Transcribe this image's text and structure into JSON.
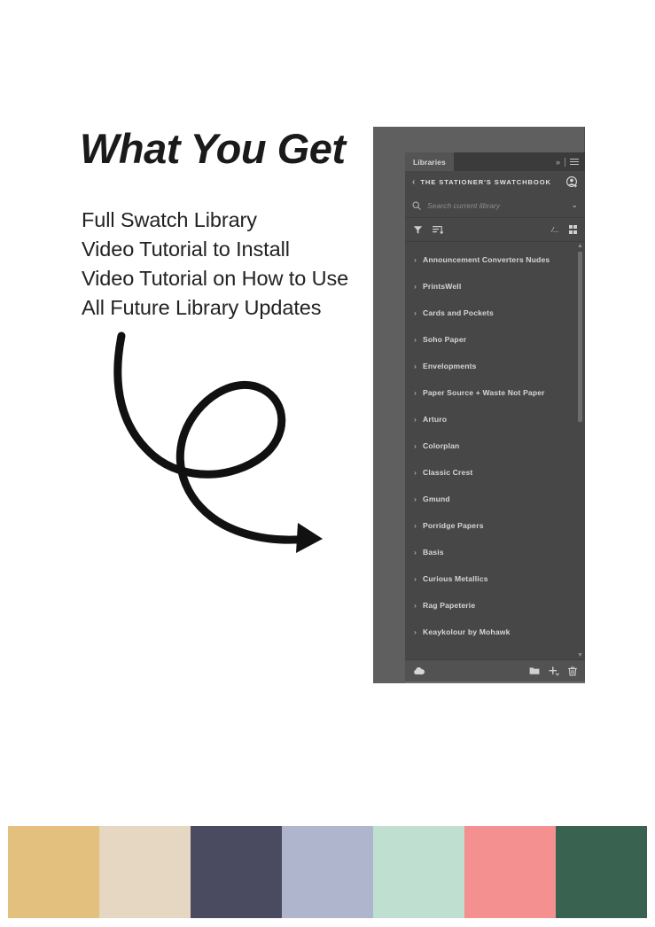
{
  "headline": "What You Get",
  "features": [
    "Full Swatch Library",
    "Video Tutorial to Install",
    "Video Tutorial on How to Use",
    "All Future Library Updates"
  ],
  "panel": {
    "tab_label": "Libraries",
    "collapse_icon": "»",
    "library_title": "THE STATIONER'S SWATCHBOOK",
    "back_icon": "‹",
    "search_placeholder": "Search current library",
    "search_value": "",
    "view_label": "/...",
    "items": [
      {
        "label": "Announcement Converters Nudes"
      },
      {
        "label": "PrintsWell"
      },
      {
        "label": "Cards and Pockets"
      },
      {
        "label": "Soho Paper"
      },
      {
        "label": "Envelopments"
      },
      {
        "label": "Paper Source + Waste Not Paper"
      },
      {
        "label": "Arturo"
      },
      {
        "label": "Colorplan"
      },
      {
        "label": "Classic Crest"
      },
      {
        "label": "Gmund"
      },
      {
        "label": "Porridge Papers"
      },
      {
        "label": "Basis"
      },
      {
        "label": "Curious Metallics"
      },
      {
        "label": "Rag Papeterie"
      },
      {
        "label": "Keaykolour by Mohawk"
      }
    ],
    "chevron_right": "›",
    "chevron_down": "⌄"
  },
  "palette": {
    "swatches": [
      {
        "name": "gold",
        "color": "#e3c07d"
      },
      {
        "name": "cream",
        "color": "#e6d7c3"
      },
      {
        "name": "navy",
        "color": "#4a4a61"
      },
      {
        "name": "periwinkle",
        "color": "#afb5cc"
      },
      {
        "name": "mint",
        "color": "#bfdfd0"
      },
      {
        "name": "coral",
        "color": "#f59090"
      },
      {
        "name": "forest",
        "color": "#3a6250"
      }
    ]
  }
}
